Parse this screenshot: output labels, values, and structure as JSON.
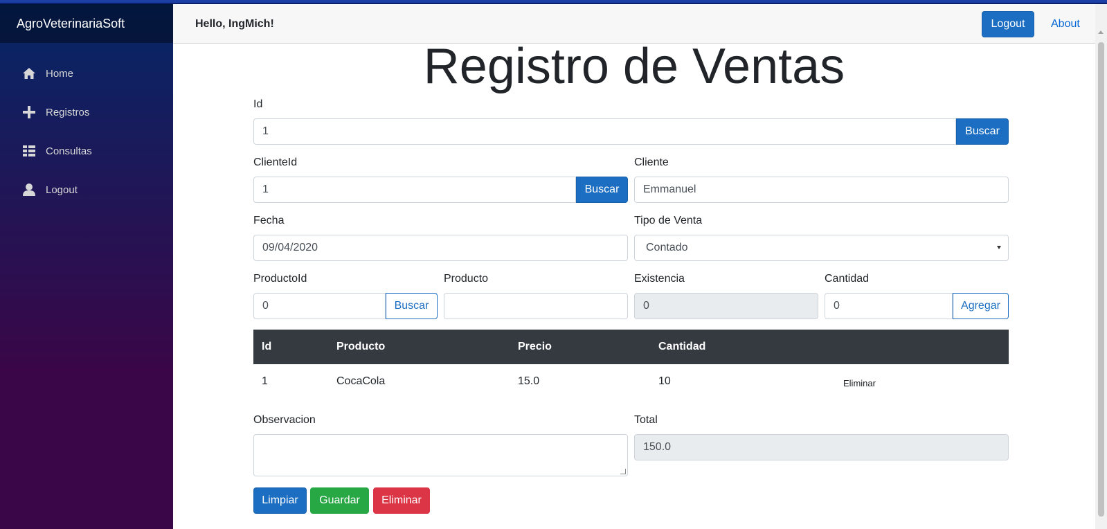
{
  "app": {
    "brand": "AgroVeterinariaSoft"
  },
  "sidebar": {
    "items": [
      {
        "label": "Home",
        "icon": "home-icon"
      },
      {
        "label": "Registros",
        "icon": "plus-icon"
      },
      {
        "label": "Consultas",
        "icon": "list-icon"
      },
      {
        "label": "Logout",
        "icon": "person-icon"
      }
    ]
  },
  "topbar": {
    "greeting": "Hello, IngMich!",
    "logout_label": "Logout",
    "about_label": "About"
  },
  "page": {
    "title": "Registro de Ventas"
  },
  "form": {
    "id_label": "Id",
    "id_value": "1",
    "id_search": "Buscar",
    "cliente_id_label": "ClienteId",
    "cliente_id_value": "1",
    "cliente_id_search": "Buscar",
    "cliente_label": "Cliente",
    "cliente_value": "Emmanuel",
    "fecha_label": "Fecha",
    "fecha_value": "09/04/2020",
    "tipo_label": "Tipo de Venta",
    "tipo_value": "Contado",
    "producto_id_label": "ProductoId",
    "producto_id_value": "0",
    "producto_id_search": "Buscar",
    "producto_label": "Producto",
    "producto_value": "",
    "existencia_label": "Existencia",
    "existencia_value": "0",
    "cantidad_label": "Cantidad",
    "cantidad_value": "0",
    "agregar_label": "Agregar",
    "observacion_label": "Observacion",
    "observacion_value": "",
    "total_label": "Total",
    "total_value": "150.0"
  },
  "table": {
    "headers": [
      "Id",
      "Producto",
      "Precio",
      "Cantidad"
    ],
    "rows": [
      {
        "id": "1",
        "producto": "CocaCola",
        "precio": "15.0",
        "cantidad": "10",
        "action": "Eliminar"
      }
    ]
  },
  "actions": {
    "limpiar": "Limpiar",
    "guardar": "Guardar",
    "eliminar": "Eliminar"
  },
  "colors": {
    "primary": "#1b6ec2",
    "success": "#28a745",
    "danger": "#dc3545",
    "table_header": "#343a40"
  }
}
